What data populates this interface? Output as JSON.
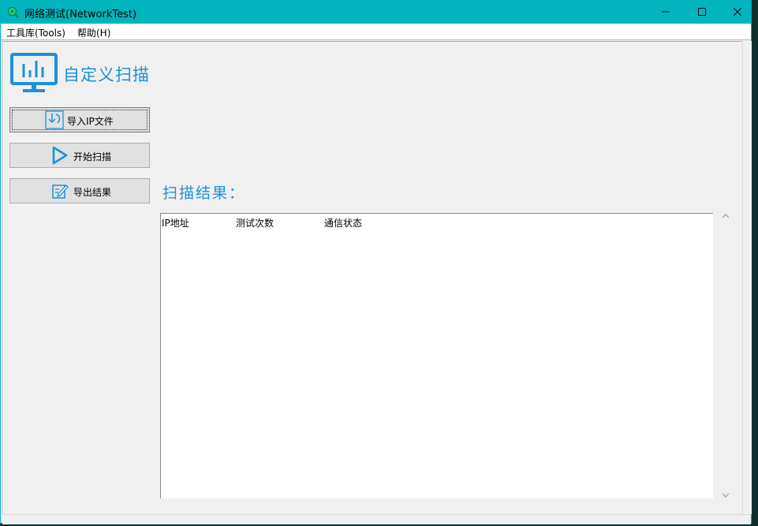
{
  "window": {
    "title": "网络测试(NetworkTest)",
    "icon": "magnifier-app-icon",
    "controls": [
      "minimize-icon",
      "maximize-icon",
      "close-icon"
    ]
  },
  "menu": {
    "items": [
      {
        "label": "工具库(Tools)"
      },
      {
        "label": "帮助(H)"
      }
    ]
  },
  "header": {
    "title": "自定义扫描",
    "icon": "monitor-chart-icon"
  },
  "actions": [
    {
      "label": "导入IP文件",
      "icon": "import-file-icon"
    },
    {
      "label": "开始扫描",
      "icon": "play-icon"
    },
    {
      "label": "导出结果",
      "icon": "export-edit-icon"
    }
  ],
  "results": {
    "title": "扫描结果：",
    "columns": [
      "IP地址",
      "测试次数",
      "通信状态"
    ],
    "rows": []
  },
  "colors": {
    "titlebar": "#00b5be",
    "accent": "#1e90d7",
    "background": "#f0f0f0"
  }
}
